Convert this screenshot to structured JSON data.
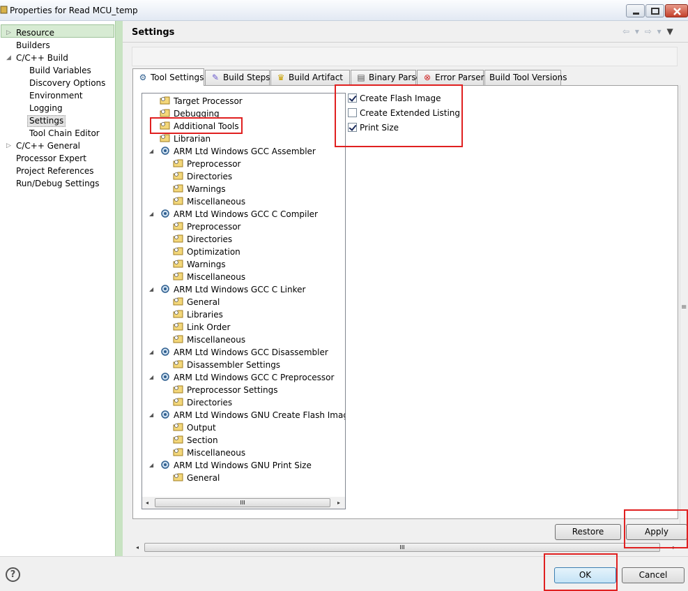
{
  "window": {
    "title": "Properties for Read MCU_temp"
  },
  "left_nav": {
    "filter_placeholder": "",
    "items": [
      {
        "label": "Resource",
        "expander": "▷"
      },
      {
        "label": "Builders",
        "expander": ""
      },
      {
        "label": "C/C++ Build",
        "expander": "◢"
      },
      {
        "label": "Build Variables",
        "expander": ""
      },
      {
        "label": "Discovery Options",
        "expander": ""
      },
      {
        "label": "Environment",
        "expander": ""
      },
      {
        "label": "Logging",
        "expander": ""
      },
      {
        "label": "Settings",
        "expander": ""
      },
      {
        "label": "Tool Chain Editor",
        "expander": ""
      },
      {
        "label": "C/C++ General",
        "expander": "▷"
      },
      {
        "label": "Processor Expert",
        "expander": ""
      },
      {
        "label": "Project References",
        "expander": ""
      },
      {
        "label": "Run/Debug Settings",
        "expander": ""
      }
    ]
  },
  "header": {
    "title": "Settings",
    "back_icon": "⇦",
    "forward_icon": "⇨",
    "menu_icon": "▼"
  },
  "tabs": [
    {
      "label": "Tool Settings"
    },
    {
      "label": "Build Steps"
    },
    {
      "label": "Build Artifact"
    },
    {
      "label": "Binary Parsers"
    },
    {
      "label": "Error Parsers"
    },
    {
      "label": "Build Tool Versions"
    }
  ],
  "tool_tree": [
    {
      "label": "Target Processor"
    },
    {
      "label": "Debugging"
    },
    {
      "label": "Additional Tools"
    },
    {
      "label": "Librarian"
    },
    {
      "label": "ARM Ltd Windows GCC Assembler",
      "expander": "◢"
    },
    {
      "label": "Preprocessor"
    },
    {
      "label": "Directories"
    },
    {
      "label": "Warnings"
    },
    {
      "label": "Miscellaneous"
    },
    {
      "label": "ARM Ltd Windows GCC C Compiler",
      "expander": "◢"
    },
    {
      "label": "Preprocessor"
    },
    {
      "label": "Directories"
    },
    {
      "label": "Optimization"
    },
    {
      "label": "Warnings"
    },
    {
      "label": "Miscellaneous"
    },
    {
      "label": "ARM Ltd Windows GCC C Linker",
      "expander": "◢"
    },
    {
      "label": "General"
    },
    {
      "label": "Libraries"
    },
    {
      "label": "Link Order"
    },
    {
      "label": "Miscellaneous"
    },
    {
      "label": "ARM Ltd Windows GCC Disassembler",
      "expander": "◢"
    },
    {
      "label": "Disassembler Settings"
    },
    {
      "label": "ARM Ltd Windows GCC C Preprocessor",
      "expander": "◢"
    },
    {
      "label": "Preprocessor Settings"
    },
    {
      "label": "Directories"
    },
    {
      "label": "ARM Ltd Windows GNU Create Flash Image",
      "expander": "◢"
    },
    {
      "label": "Output"
    },
    {
      "label": "Section"
    },
    {
      "label": "Miscellaneous"
    },
    {
      "label": "ARM Ltd Windows GNU Print Size",
      "expander": "◢"
    },
    {
      "label": "General"
    }
  ],
  "scroll": {
    "thumb_grip": "III",
    "left_arrow": "◂",
    "right_arrow": "▸",
    "v_grip": "≡"
  },
  "options": [
    {
      "label": "Create Flash Image",
      "checked": true
    },
    {
      "label": "Create Extended Listing",
      "checked": false
    },
    {
      "label": "Print Size",
      "checked": true
    }
  ],
  "buttons": {
    "restore_defaults": "Restore Defaults",
    "apply": "Apply",
    "ok": "OK",
    "cancel": "Cancel",
    "help": "?"
  }
}
